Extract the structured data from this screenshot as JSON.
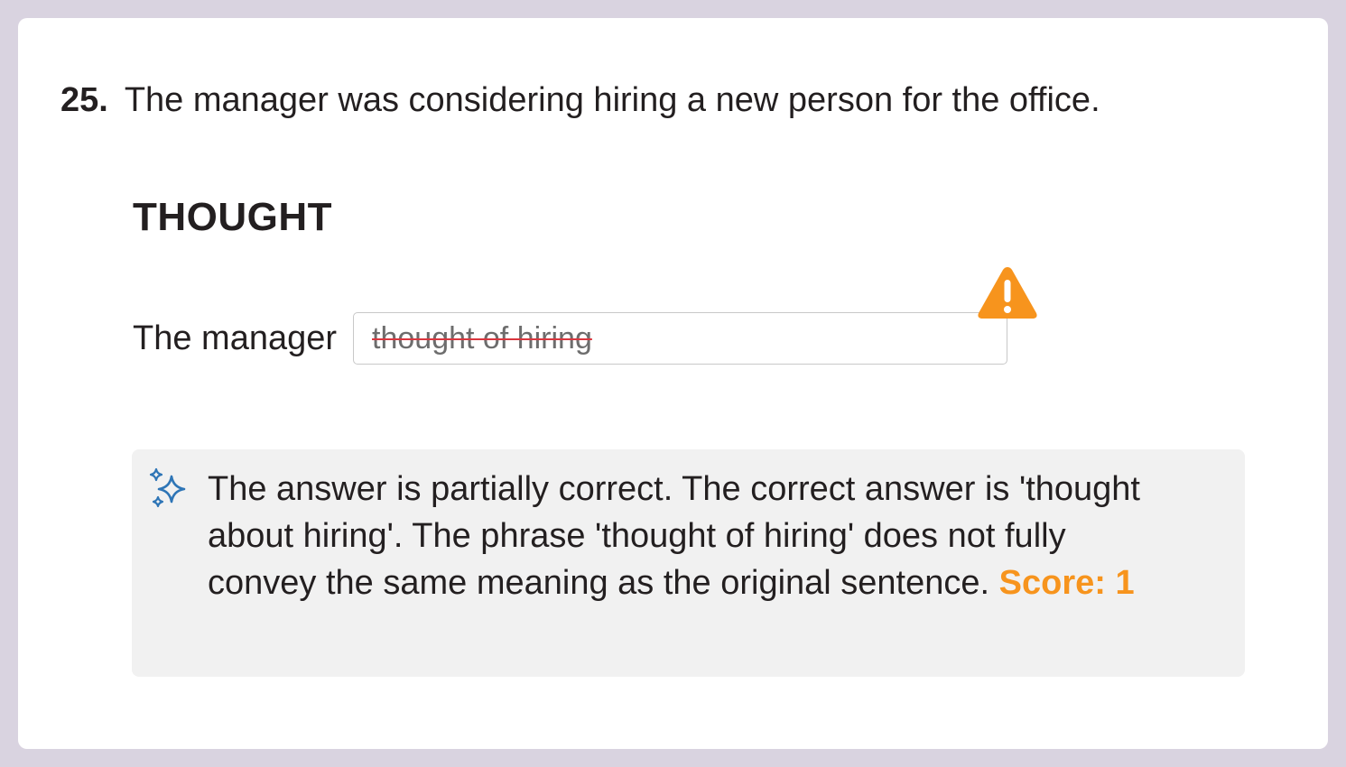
{
  "question": {
    "number": "25.",
    "text": "The manager was considering hiring a new person for the office."
  },
  "keyword": "THOUGHT",
  "answer": {
    "prefix": "The manager",
    "value": "thought of hiring",
    "status": "partially-correct",
    "status_icon": "warning-icon"
  },
  "feedback": {
    "icon": "sparkle-icon",
    "text": "The answer is partially correct. The correct answer is 'thought about hiring'. The phrase 'thought of hiring' does not fully convey the same meaning as the original sentence.",
    "score_label": "Score: 1"
  },
  "colors": {
    "background": "#d9d3e0",
    "card": "#ffffff",
    "warning": "#f7941d",
    "strikethrough": "#d9363e",
    "sparkle": "#2e75b6",
    "feedback_bg": "#f1f1f1"
  }
}
